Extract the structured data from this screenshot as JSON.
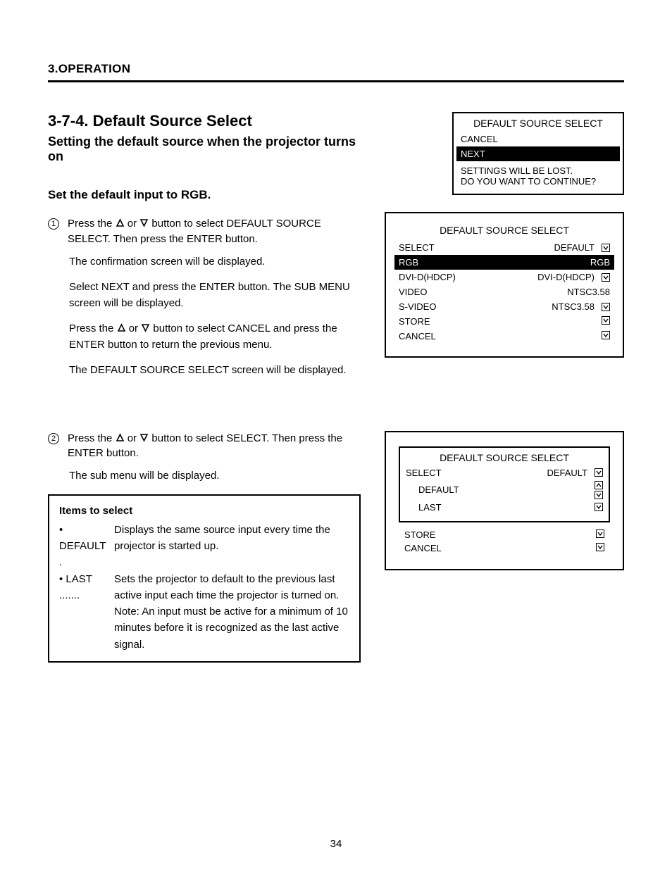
{
  "page": {
    "section_header": "3.OPERATION",
    "title": "3-7-4. Default Source Select",
    "subtitle": "Setting the default source when the projector turns on",
    "sec1": {
      "heading": "Set the default input to RGB.",
      "step1_pre": "Press the",
      "step1_or": "or",
      "step1_post": "button to select DEFAULT SOURCE SELECT. Then press the ENTER button.",
      "p1": "The confirmation screen will be displayed.",
      "p2_pre": "Select NEXT and press the ENTER button. The",
      "p2_sub": "SUB MENU screen will be displayed.",
      "note_pre": "Press the",
      "note_or": "or",
      "note_post": "button to select CANCEL and press the ENTER button to return the previous menu.",
      "p3": "The DEFAULT SOURCE SELECT screen will be displayed."
    },
    "sec2": {
      "step2_pre": "Press the",
      "step2_or": "or",
      "step2_post": "button to select SELECT. Then press the ENTER button.",
      "p1": "The sub menu will be displayed."
    },
    "infobox": {
      "title": "Items to select",
      "rows": [
        {
          "label": "DEFAULT .",
          "desc": "Displays the same source input every time the projector is started up."
        },
        {
          "label": "LAST .......",
          "desc": "Sets the projector to default to the previous last active input each time the projector is turned on. Note: An input must be active for a minimum of 10 minutes before it is recognized as the last active signal."
        }
      ]
    },
    "panel1": {
      "title": "DEFAULT SOURCE SELECT",
      "rows": [
        {
          "label": "CANCEL",
          "sel": false
        },
        {
          "label": "NEXT",
          "sel": true
        }
      ],
      "msg1": "SETTINGS WILL BE LOST.",
      "msg2": "DO YOU WANT TO CONTINUE?"
    },
    "panel2": {
      "title": "DEFAULT SOURCE SELECT",
      "top": [
        {
          "label": "SELECT",
          "value": "DEFAULT",
          "arrow": true,
          "sel": false
        }
      ],
      "highlight": {
        "label": "RGB",
        "value": "RGB",
        "arrow": false,
        "sel": true
      },
      "rest": [
        {
          "label": "DVI-D(HDCP)",
          "value": "DVI-D(HDCP)",
          "arrow": true
        },
        {
          "label": "VIDEO",
          "value": "NTSC3.58",
          "arrow": false
        },
        {
          "label": "S-VIDEO",
          "value": "NTSC3.58",
          "arrow": true
        },
        {
          "label": "STORE",
          "value": "",
          "arrow": true
        },
        {
          "label": "CANCEL",
          "value": "",
          "arrow": true
        }
      ]
    },
    "panel3": {
      "inner_title": "DEFAULT SOURCE SELECT",
      "inner_rows": [
        {
          "label": "SELECT",
          "value": "DEFAULT",
          "arrow": true
        },
        {
          "label_only": true,
          "opt_label": "DEFAULT",
          "right_value": "",
          "stack": true
        },
        {
          "label_only": true,
          "opt_label": "LAST",
          "right_value": "",
          "arrow": true
        }
      ],
      "below": [
        {
          "label": "STORE",
          "arrow": true
        },
        {
          "label": "CANCEL",
          "arrow": true
        }
      ]
    },
    "page_number": "34"
  }
}
